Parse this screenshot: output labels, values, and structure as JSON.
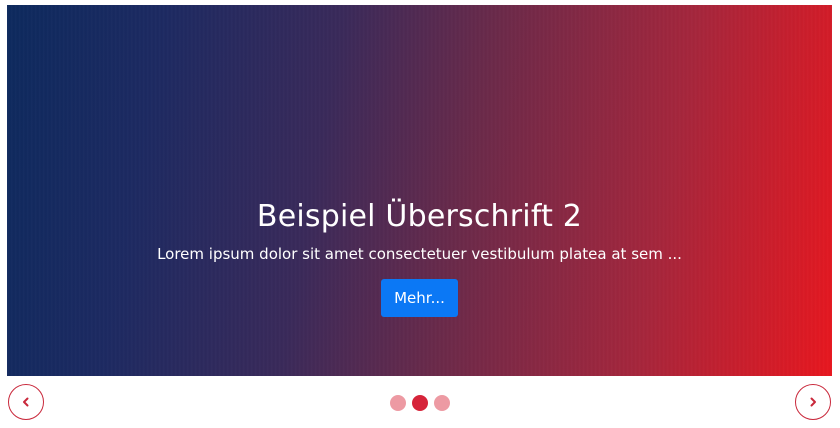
{
  "carousel": {
    "active_index": 2,
    "slide_count": 3,
    "slide": {
      "title": "Beispiel Überschrift 2",
      "text": "Lorem ipsum dolor sit amet consectetuer vestibulum platea at sem ...",
      "button_label": "Mehr..."
    },
    "prev_icon": "chevron-left-icon",
    "next_icon": "chevron-right-icon",
    "colors": {
      "gradient_start": "#0d2a5e",
      "gradient_end": "#e8171f",
      "button": "#0b78f5",
      "accent": "#c9283b",
      "dot_inactive": "#ed9aa3",
      "dot_active": "#d6243a"
    }
  }
}
